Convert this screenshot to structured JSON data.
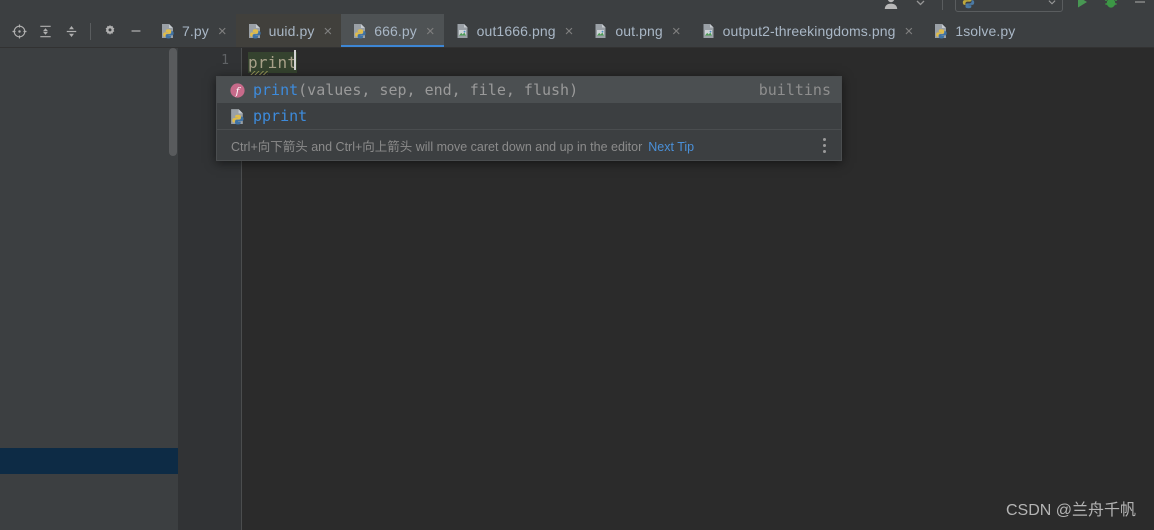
{
  "top_toolbar": {
    "icons": [
      "user-avatar-icon",
      "chevron-down-icon",
      "divider",
      "python-interpreter-combo",
      "run-icon",
      "debug-icon",
      "more-icon"
    ],
    "combo_label": ""
  },
  "tool_icons": [
    {
      "name": "locate-target-icon",
      "label": ""
    },
    {
      "name": "expand-all-icon",
      "label": ""
    },
    {
      "name": "collapse-all-icon",
      "label": ""
    },
    {
      "name": "divider",
      "label": ""
    },
    {
      "name": "gear-icon",
      "label": ""
    },
    {
      "name": "minimize-icon",
      "label": ""
    }
  ],
  "tabs": [
    {
      "label": "7.py",
      "icon": "python-file-icon",
      "active": false,
      "highlighted": false,
      "close": "×"
    },
    {
      "label": "uuid.py",
      "icon": "python-file-icon",
      "active": false,
      "highlighted": true,
      "close": "×"
    },
    {
      "label": "666.py",
      "icon": "python-file-icon",
      "active": true,
      "highlighted": false,
      "close": "×"
    },
    {
      "label": "out1666.png",
      "icon": "image-file-icon",
      "active": false,
      "highlighted": false,
      "close": "×"
    },
    {
      "label": "out.png",
      "icon": "image-file-icon",
      "active": false,
      "highlighted": false,
      "close": "×"
    },
    {
      "label": "output2-threekingdoms.png",
      "icon": "image-file-icon",
      "active": false,
      "highlighted": false,
      "close": "×"
    },
    {
      "label": "1solve.py",
      "icon": "python-file-icon",
      "active": false,
      "highlighted": false,
      "close": "×"
    }
  ],
  "editor": {
    "line_number": "1",
    "code_text": "print"
  },
  "completion_popup": {
    "items": [
      {
        "icon": "function-icon",
        "name": "print",
        "args": "(values, sep, end, file, flush)",
        "origin": "builtins",
        "selected": true
      },
      {
        "icon": "python-module-icon",
        "name": "pprint",
        "args": "",
        "origin": "",
        "selected": false
      }
    ],
    "hint": "Ctrl+向下箭头 and Ctrl+向上箭头 will move caret down and up in the editor",
    "hint_link": "Next Tip",
    "menu_icon": "kebab-menu-icon"
  },
  "watermark": "CSDN @兰舟千帆",
  "colors": {
    "accent_blue": "#3d86d4",
    "link_blue": "#4a90d9",
    "panel_bg": "#3c3f41",
    "editor_bg": "#2b2b2b",
    "selection_blue": "#0d2b45",
    "keyword": "#a9a18a"
  }
}
